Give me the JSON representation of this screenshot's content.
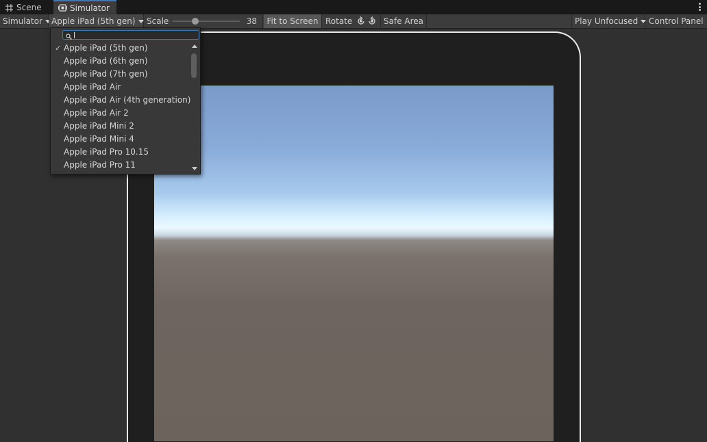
{
  "tabs": [
    {
      "label": "Scene",
      "icon": "grid-icon"
    },
    {
      "label": "Simulator",
      "icon": "device-icon",
      "active": true
    }
  ],
  "toolbar": {
    "mode_label": "Simulator",
    "device_label": "Apple iPad (5th gen)",
    "scale_label": "Scale",
    "scale_value": "38",
    "fit_label": "Fit to Screen",
    "rotate_label": "Rotate",
    "safe_area_label": "Safe Area",
    "play_mode_label": "Play Unfocused",
    "control_panel_label": "Control Panel"
  },
  "device_dropdown": {
    "search_value": "",
    "selected": "Apple iPad (5th gen)",
    "items": [
      "Apple iPad (5th gen)",
      "Apple iPad (6th gen)",
      "Apple iPad (7th gen)",
      "Apple iPad Air",
      "Apple iPad Air (4th generation)",
      "Apple iPad Air 2",
      "Apple iPad Mini 2",
      "Apple iPad Mini 4",
      "Apple iPad Pro 10.15",
      "Apple iPad Pro 11"
    ]
  },
  "colors": {
    "accent": "#3a79bb",
    "tabbar_bg": "#191919",
    "toolbar_bg": "#3c3c3c",
    "panel_bg": "#303030",
    "device_bezel": "#1f1f1f",
    "device_outline": "#ececec"
  }
}
